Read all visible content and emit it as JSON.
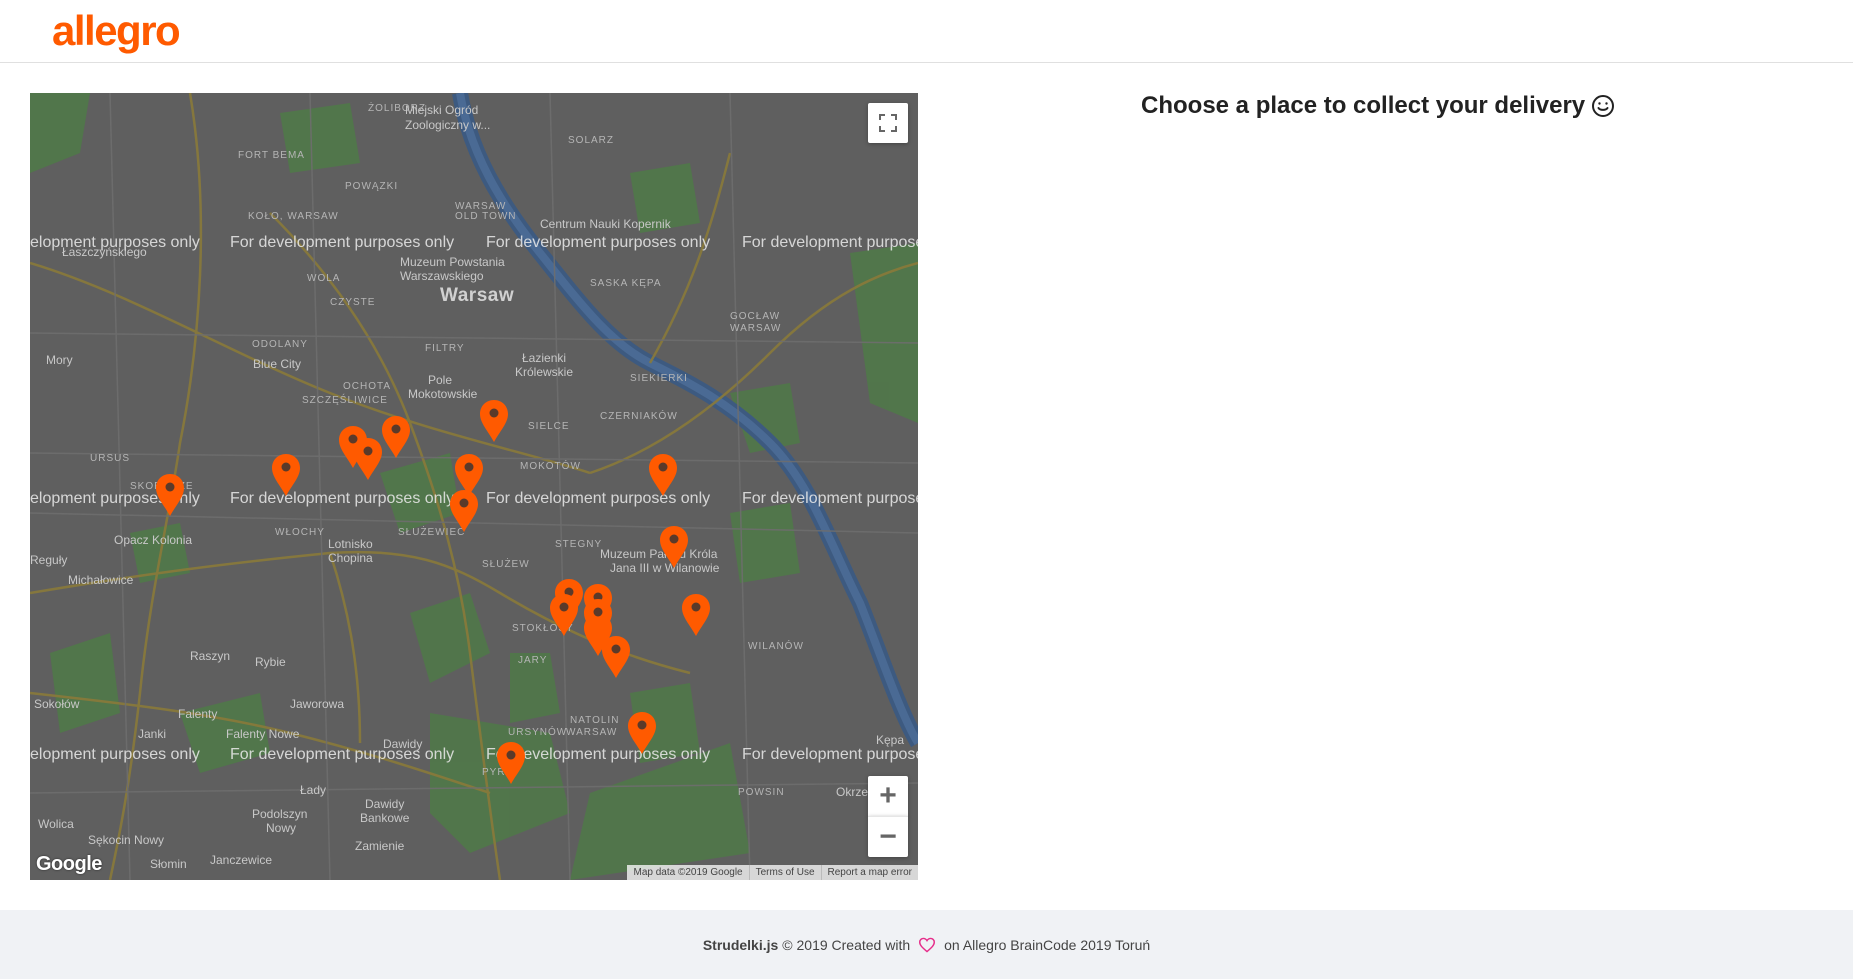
{
  "header": {
    "logo_text": "allegro"
  },
  "page": {
    "title": "Choose a place to collect your delivery"
  },
  "map": {
    "city_label": "Warsaw",
    "watermark_text": "For development purposes only",
    "watermark_fragment_left": "elopment purposes only",
    "watermark_fragment_right": "For development purposes",
    "places": {
      "zoliborz": "ŻOLIBORZ",
      "zoo": "Miejski Ogród",
      "zoo2": "Zoologiczny w...",
      "fort_bema": "FORT BEMA",
      "sluzewiec_powazki": "POWĄZKI",
      "warszawa": "WARSAW",
      "kolo": "KOŁO, WARSAW",
      "old_town": "WARSAW",
      "old_town2": "OLD TOWN",
      "kopernik": "Centrum Nauki Kopernik",
      "solarz": "SOLARZ",
      "laszczynskiego": "Łaszczyńskiego",
      "muzeum": "Muzeum Powstania",
      "muzeum2": "Warszawskiego",
      "wola": "WOLA",
      "czyste": "CZYSTE",
      "saska": "SASKA KĘPA",
      "goclaw": "GOCŁAW",
      "warsaw2": "WARSAW",
      "mory": "Mory",
      "odolany": "ODOLANY",
      "blue_city": "Blue City",
      "filtry": "FILTRY",
      "lazienki": "Łazienki",
      "lazienki2": "Królewskie",
      "siekierki": "SIEKIERKI",
      "ochota": "OCHOTA",
      "szczesliwice": "SZCZĘŚLIWICE",
      "pole": "Pole",
      "mokotowskie": "Mokotowskie",
      "sielce": "SIELCE",
      "czerniakow": "CZERNIAKÓW",
      "ursus": "URSUS",
      "mokotow": "MOKOTÓW",
      "skorosze": "SKOROSZE",
      "opacz": "Opacz Kolonia",
      "wlochy": "WŁOCHY",
      "lotnisko": "Lotnisko",
      "chopina": "Chopina",
      "sluzewiec": "SŁUŻEWIEC",
      "stegny": "STEGNY",
      "muzeum_palac": "Muzeum Pałacu Króla",
      "muzeum_palac2": "Jana III w Wilanowie",
      "reguly": "Reguły",
      "michalowice": "Michałowice",
      "sluzew": "SŁUŻEW",
      "stokłosy": "STOKŁOSY",
      "wilanow": "WILANÓW",
      "raszyn": "Raszyn",
      "rybie": "Rybie",
      "jary": "JARY",
      "sokolow": "Sokołów",
      "jaworowa": "Jaworowa",
      "falenty": "Falenty",
      "ursynow": "URSYNÓW",
      "natolin": "NATOLIN",
      "warsaw3": "WARSAW",
      "janki": "Janki",
      "falenty_nowe": "Falenty Nowe",
      "dawidy": "Dawidy",
      "kepa": "Kępa",
      "pyry": "PYRY",
      "powsin": "POWSIN",
      "okrzeszyn": "Okrze...",
      "lady": "Łady",
      "dawidy_bankowe": "Dawidy",
      "dawidy_bankowe2": "Bankowe",
      "podolszyn": "Podolszyn",
      "podolszyn2": "Nowy",
      "wolica": "Wolica",
      "sekocin": "Sękocin Nowy",
      "zamienie": "Zamienie",
      "slomin": "Słomin",
      "janczewice": "Janczewice"
    },
    "fullscreen_icon": "fullscreen-icon",
    "zoom_in_label": "+",
    "zoom_out_label": "−",
    "google_text": "Google",
    "attribution": {
      "map_data": "Map data ©2019 Google",
      "terms": "Terms of Use",
      "report": "Report a map error"
    },
    "pin_color": "#ff5a00",
    "pin_count": 19
  },
  "footer": {
    "brand": "Strudelki.js",
    "copyright": "© 2019 Created with",
    "suffix": "on Allegro BrainCode 2019 Toruń"
  },
  "colors": {
    "accent": "#ff5a00",
    "heart": "#e62e8a"
  }
}
